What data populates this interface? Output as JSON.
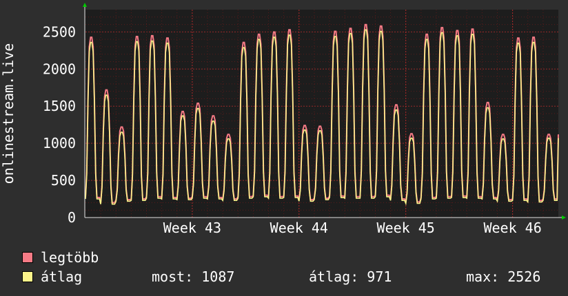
{
  "chart_data": {
    "type": "line",
    "ylabel": "onlinestream.live",
    "y_ticks": [
      0,
      500,
      1000,
      1500,
      2000,
      2500
    ],
    "x_tick_labels": [
      "Week 43",
      "Week 44",
      "Week 45",
      "Week 46"
    ],
    "ylim": [
      0,
      2800
    ],
    "grid": true,
    "x_unit": "day",
    "days": 31,
    "week_label_day": [
      7,
      14,
      21,
      28
    ],
    "daily_peaks": {
      "legtöbb": [
        2430,
        1720,
        1220,
        2440,
        2450,
        2420,
        1430,
        1540,
        1370,
        1120,
        2360,
        2470,
        2500,
        2530,
        1240,
        1230,
        2510,
        2550,
        2600,
        2580,
        1520,
        1130,
        2470,
        2560,
        2520,
        2540,
        1550,
        1120,
        2420,
        2430,
        1120
      ],
      "átlag": [
        2360,
        1650,
        1150,
        2370,
        2380,
        2350,
        1370,
        1470,
        1300,
        1060,
        2290,
        2400,
        2430,
        2460,
        1180,
        1170,
        2440,
        2480,
        2530,
        2510,
        1450,
        1070,
        2400,
        2490,
        2450,
        2470,
        1480,
        1060,
        2350,
        2360,
        1070
      ]
    },
    "daily_troughs": [
      250,
      180,
      220,
      230,
      260,
      250,
      240,
      260,
      250,
      230,
      260,
      280,
      260,
      270,
      220,
      240,
      270,
      260,
      260,
      280,
      230,
      190,
      250,
      260,
      270,
      260,
      250,
      220,
      230,
      210,
      230
    ],
    "series": [
      {
        "name": "legtöbb",
        "color": "#f77b86"
      },
      {
        "name": "átlag",
        "color": "#fbf38a"
      }
    ]
  },
  "legend": [
    {
      "label": "legtöbb",
      "color": "#f77b86"
    },
    {
      "label": "átlag",
      "color": "#fbf38a"
    }
  ],
  "stats": {
    "current": "most: 1087",
    "average": "átlag: 971",
    "max": "max: 2526"
  },
  "colors": {
    "background": "#2e2e2e",
    "plot": "#1d1d1d",
    "grid": "#8a2222",
    "axis_arrow": "#00cc00"
  }
}
